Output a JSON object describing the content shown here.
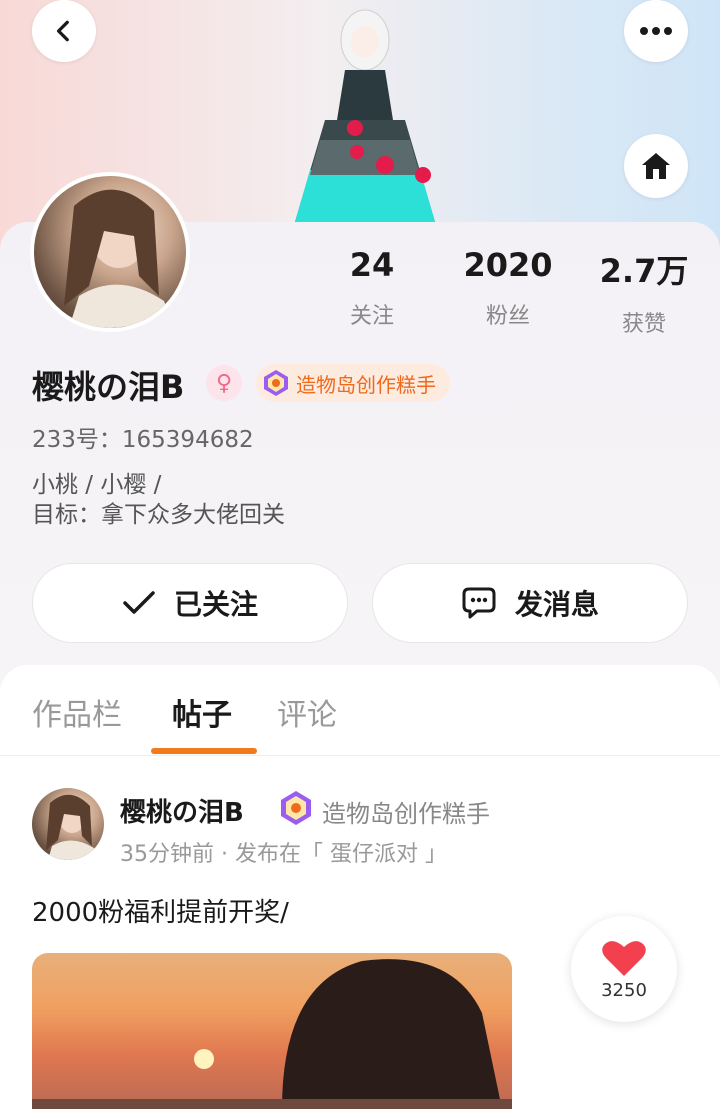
{
  "profile": {
    "name": "樱桃の泪B",
    "creator_badge": "造物岛创作糕手",
    "uid": "233号：165394682",
    "bio_line1": "小桃 / 小樱 /",
    "bio_line2": "目标：拿下众多大佬回关"
  },
  "stats": [
    {
      "value": "24",
      "label": "关注"
    },
    {
      "value": "2020",
      "label": "粉丝"
    },
    {
      "value": "2.7万",
      "label": "获赞"
    }
  ],
  "actions": {
    "follow_label": "已关注",
    "message_label": "发消息"
  },
  "tabs": [
    {
      "label": "作品栏"
    },
    {
      "label": "帖子"
    },
    {
      "label": "评论"
    }
  ],
  "active_tab": "帖子",
  "post": {
    "author": "樱桃の泪B",
    "badge": "造物岛创作糕手",
    "meta": "35分钟前 · 发布在「 蛋仔派对 」",
    "text": "2000粉福利提前开奖/",
    "likes": "3250"
  },
  "icons": {
    "back": "chevron-left-icon",
    "more": "more-dots-icon",
    "home": "home-icon",
    "gender": "female-icon",
    "check": "check-icon",
    "message": "chat-bubble-icon",
    "heart": "heart-icon"
  },
  "colors": {
    "accent": "#f07a1c",
    "badge_text": "#ef6a1a",
    "like": "#f2404f"
  }
}
